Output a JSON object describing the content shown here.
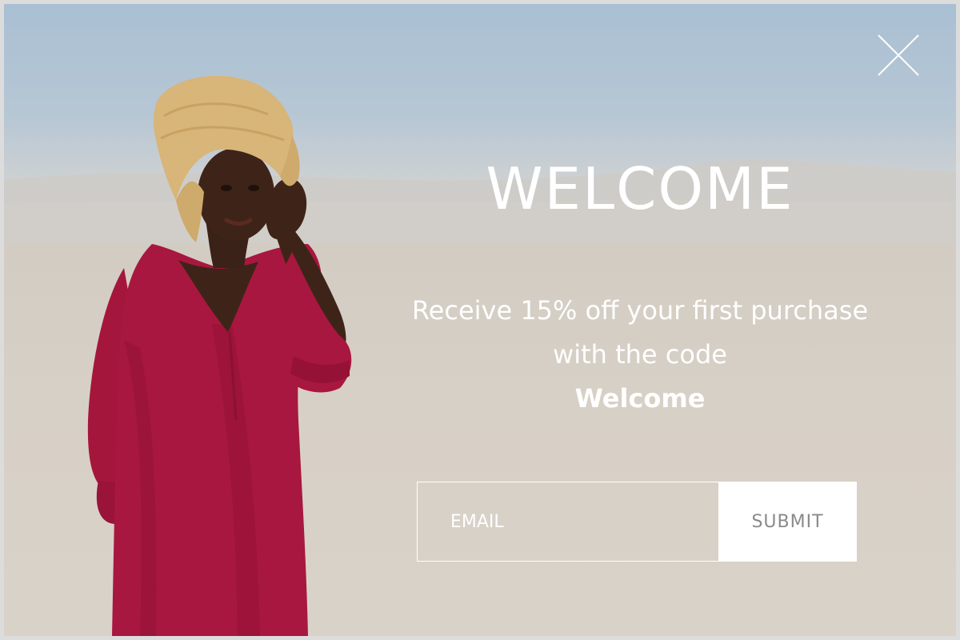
{
  "popup": {
    "title": "WELCOME",
    "offer_line": "Receive 15% off your first purchase with the code",
    "promo_code": "Welcome"
  },
  "form": {
    "email_placeholder": "EMAIL",
    "email_value": "",
    "submit_label": "SUBMIT"
  },
  "icons": {
    "close": "close-icon"
  },
  "colors": {
    "sky": "#a9bfd3",
    "sand": "#d8d2c8",
    "dress": "#a8173f",
    "hat": "#d8b578",
    "text": "#ffffff",
    "submit_text": "#8a8a8a"
  }
}
